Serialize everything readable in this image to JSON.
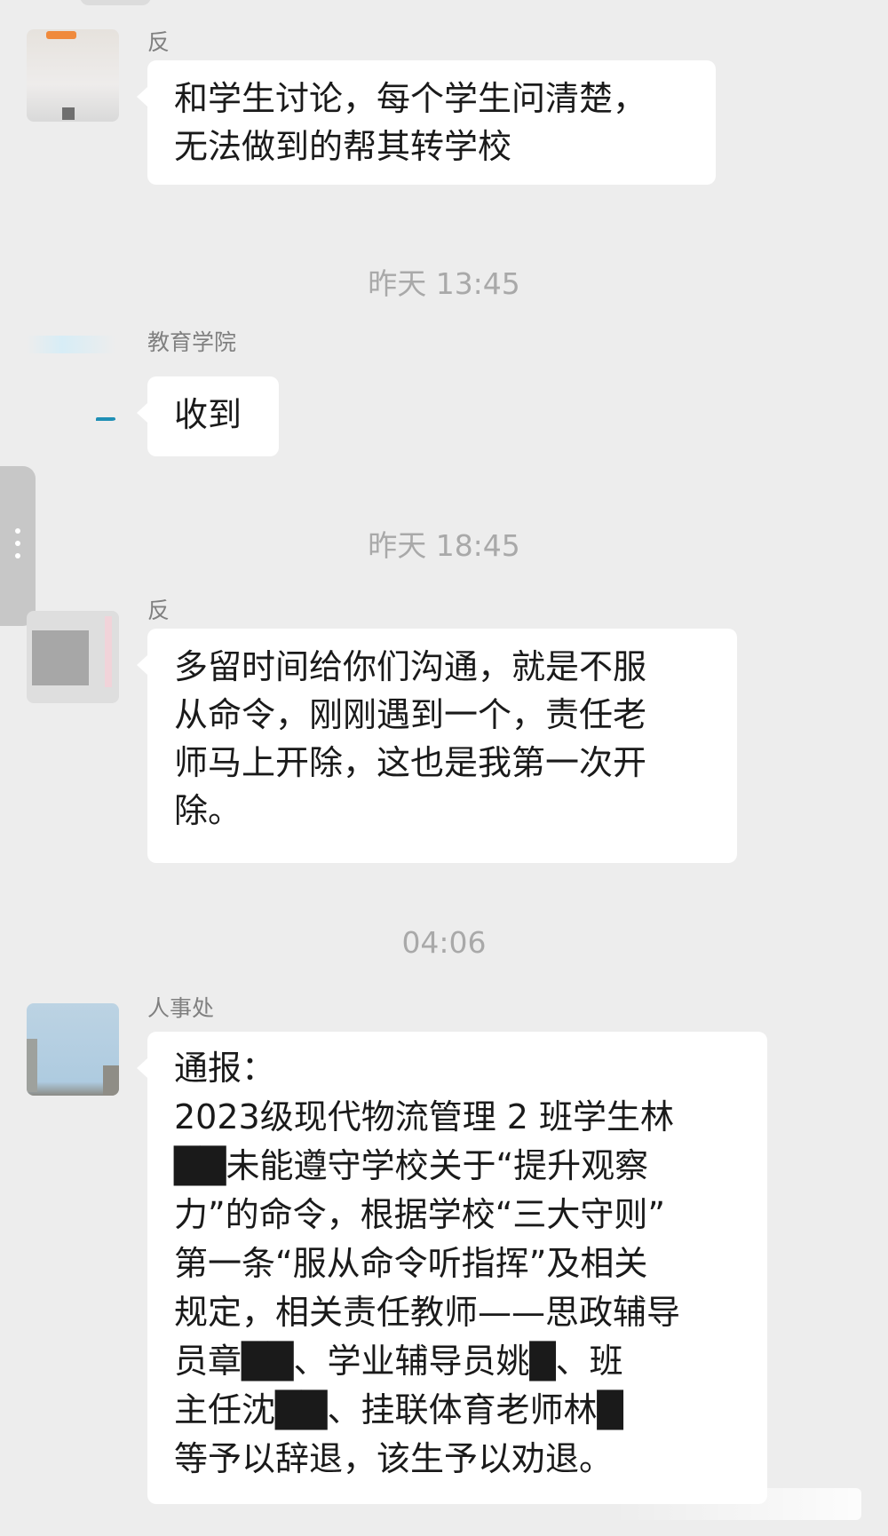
{
  "messages": [
    {
      "sender": "反",
      "lines": [
        "和学生讨论，每个学生问清楚，",
        "无法做到的帮其转学校"
      ]
    },
    {
      "sender": "教育学院",
      "lines": [
        "收到"
      ]
    },
    {
      "sender": "反",
      "lines": [
        "多留时间给你们沟通，就是不服",
        "从命令，刚刚遇到一个，责任老",
        "师马上开除，这也是我第一次开",
        "除。"
      ]
    },
    {
      "sender": "人事处",
      "lines": [
        "通报：",
        "2023级现代物流管理 2 班学生林",
        "██未能遵守学校关于“提升观察",
        "力”的命令，根据学校“三大守则”",
        "第一条“服从命令听指挥”及相关",
        "规定，相关责任教师——思政辅导",
        "员章██、学业辅导员姚█、班",
        "主任沈██、挂联体育老师林█",
        "等予以辞退，该生予以劝退。"
      ]
    }
  ],
  "timestamps": [
    "昨天 13:45",
    "昨天 18:45",
    "04:06"
  ],
  "colors": {
    "background": "#ededed",
    "bubble": "#ffffff",
    "text": "#1a1a1a",
    "meta_text": "#a9a9a9"
  }
}
